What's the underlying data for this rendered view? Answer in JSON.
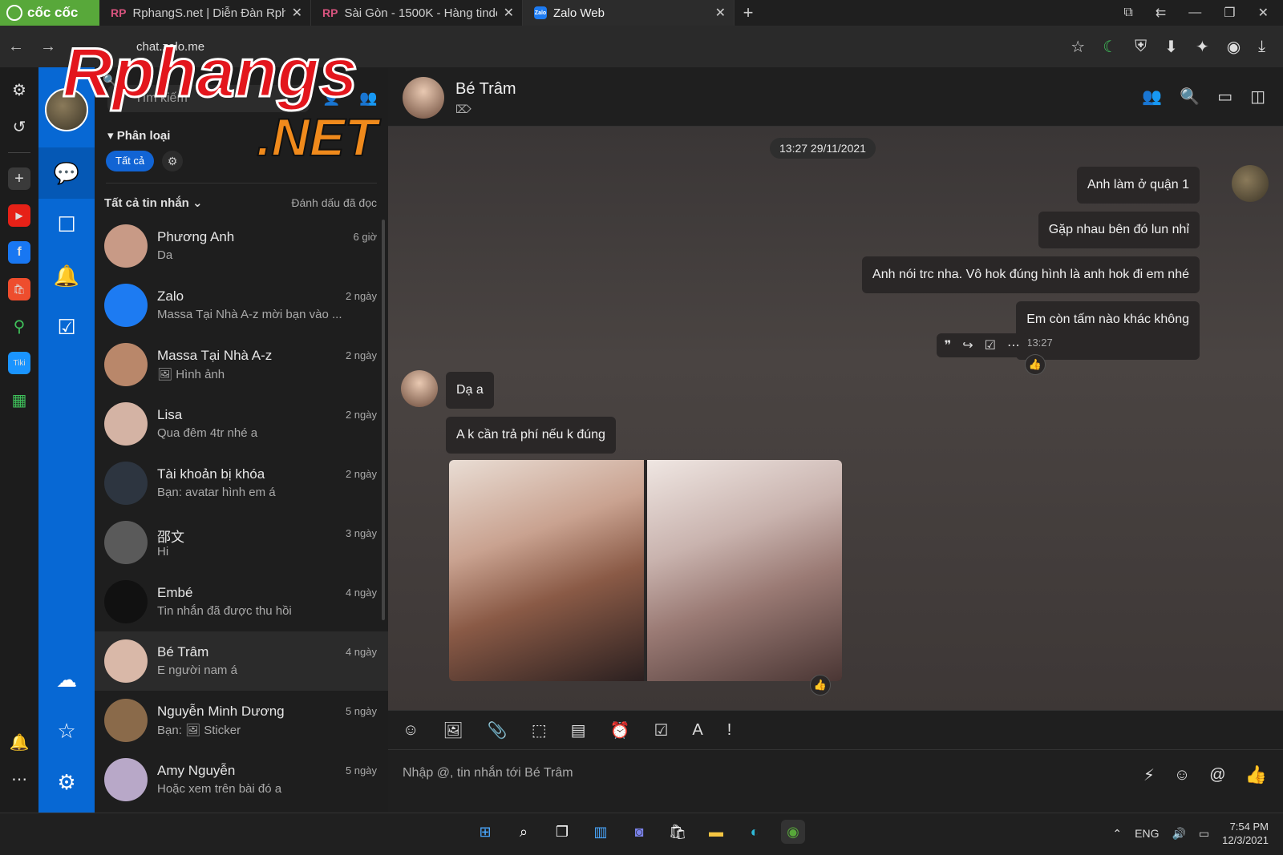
{
  "browser": {
    "brand": "cốc cốc",
    "tabs": [
      {
        "favicon": "RP",
        "title": "RphangS.net | Diễn Đàn Rpha"
      },
      {
        "favicon": "RP",
        "title": "Sài Gòn - 1500K - Hàng tinde"
      },
      {
        "favicon": "Zalo",
        "title": "Zalo Web"
      }
    ],
    "url": "chat.zalo.me"
  },
  "watermark": {
    "line1": "Rphangs",
    "line2": ".NET"
  },
  "sidebar": {
    "search_placeholder": "Tìm kiếm",
    "category_label": "Phân loại",
    "chip_all": "Tất cả",
    "all_messages": "Tất cả tin nhắn",
    "mark_read": "Đánh dấu đã đọc"
  },
  "conversations": [
    {
      "name": "Phương Anh",
      "preview": "Da",
      "time": "6 giờ",
      "avatar": "#c89a86"
    },
    {
      "name": "Zalo",
      "preview": "Massa Tại Nhà A-z mời bạn vào ...",
      "time": "2 ngày",
      "avatar": "#1d7bf2"
    },
    {
      "name": "Massa Tại Nhà A-z",
      "preview": "🖼 Hình ảnh",
      "time": "2 ngày",
      "avatar": "#b9876a"
    },
    {
      "name": "Lisa",
      "preview": "Qua đêm 4tr nhé a",
      "time": "2 ngày",
      "avatar": "#d4b3a4"
    },
    {
      "name": "Tài khoản bị khóa",
      "preview": "Bạn: avatar hình em á",
      "time": "2 ngày",
      "avatar": "#2d3540"
    },
    {
      "name": "邵文",
      "preview": "Hi",
      "time": "3 ngày",
      "avatar": "#5a5a5a"
    },
    {
      "name": "Embé",
      "preview": "Tin nhắn đã được thu hồi",
      "time": "4 ngày",
      "avatar": "#111111"
    },
    {
      "name": "Bé Trâm",
      "preview": "E người nam á",
      "time": "4 ngày",
      "avatar": "#d9b8a8"
    },
    {
      "name": "Nguyễn Minh Dương",
      "preview": "Bạn: 🖼 Sticker",
      "time": "5 ngày",
      "avatar": "#8a6a4a"
    },
    {
      "name": "Amy Nguyễn",
      "preview": "Hoặc xem trên bài đó a",
      "time": "5 ngày",
      "avatar": "#b8a8c8"
    }
  ],
  "chat": {
    "name": "Bé Trâm",
    "date": "13:27 29/11/2021",
    "messages": [
      "Anh làm ở quận 1",
      "Gặp nhau bên đó lun nhỉ",
      "Anh nói trc nha. Vô hok đúng hình là anh hok đi em nhé",
      "Em còn tấm nào khác không",
      "Dạ a",
      "A k cần trả phí nếu k đúng"
    ],
    "last_time": "13:27",
    "input_placeholder": "Nhập @, tin nhắn tới Bé Trâm"
  },
  "taskbar": {
    "lang": "ENG",
    "time": "7:54 PM",
    "date": "12/3/2021"
  }
}
